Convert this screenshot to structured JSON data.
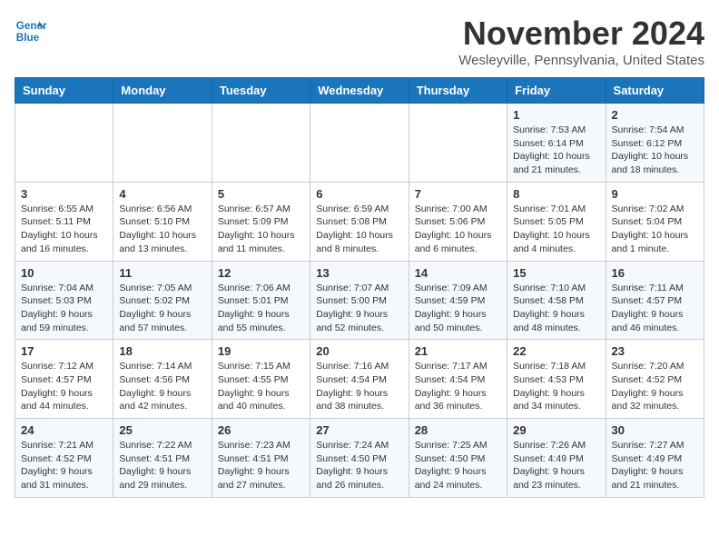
{
  "header": {
    "logo_general": "General",
    "logo_blue": "Blue",
    "month_title": "November 2024",
    "location": "Wesleyville, Pennsylvania, United States"
  },
  "weekdays": [
    "Sunday",
    "Monday",
    "Tuesday",
    "Wednesday",
    "Thursday",
    "Friday",
    "Saturday"
  ],
  "weeks": [
    [
      {
        "day": "",
        "info": ""
      },
      {
        "day": "",
        "info": ""
      },
      {
        "day": "",
        "info": ""
      },
      {
        "day": "",
        "info": ""
      },
      {
        "day": "",
        "info": ""
      },
      {
        "day": "1",
        "info": "Sunrise: 7:53 AM\nSunset: 6:14 PM\nDaylight: 10 hours and 21 minutes."
      },
      {
        "day": "2",
        "info": "Sunrise: 7:54 AM\nSunset: 6:12 PM\nDaylight: 10 hours and 18 minutes."
      }
    ],
    [
      {
        "day": "3",
        "info": "Sunrise: 6:55 AM\nSunset: 5:11 PM\nDaylight: 10 hours and 16 minutes."
      },
      {
        "day": "4",
        "info": "Sunrise: 6:56 AM\nSunset: 5:10 PM\nDaylight: 10 hours and 13 minutes."
      },
      {
        "day": "5",
        "info": "Sunrise: 6:57 AM\nSunset: 5:09 PM\nDaylight: 10 hours and 11 minutes."
      },
      {
        "day": "6",
        "info": "Sunrise: 6:59 AM\nSunset: 5:08 PM\nDaylight: 10 hours and 8 minutes."
      },
      {
        "day": "7",
        "info": "Sunrise: 7:00 AM\nSunset: 5:06 PM\nDaylight: 10 hours and 6 minutes."
      },
      {
        "day": "8",
        "info": "Sunrise: 7:01 AM\nSunset: 5:05 PM\nDaylight: 10 hours and 4 minutes."
      },
      {
        "day": "9",
        "info": "Sunrise: 7:02 AM\nSunset: 5:04 PM\nDaylight: 10 hours and 1 minute."
      }
    ],
    [
      {
        "day": "10",
        "info": "Sunrise: 7:04 AM\nSunset: 5:03 PM\nDaylight: 9 hours and 59 minutes."
      },
      {
        "day": "11",
        "info": "Sunrise: 7:05 AM\nSunset: 5:02 PM\nDaylight: 9 hours and 57 minutes."
      },
      {
        "day": "12",
        "info": "Sunrise: 7:06 AM\nSunset: 5:01 PM\nDaylight: 9 hours and 55 minutes."
      },
      {
        "day": "13",
        "info": "Sunrise: 7:07 AM\nSunset: 5:00 PM\nDaylight: 9 hours and 52 minutes."
      },
      {
        "day": "14",
        "info": "Sunrise: 7:09 AM\nSunset: 4:59 PM\nDaylight: 9 hours and 50 minutes."
      },
      {
        "day": "15",
        "info": "Sunrise: 7:10 AM\nSunset: 4:58 PM\nDaylight: 9 hours and 48 minutes."
      },
      {
        "day": "16",
        "info": "Sunrise: 7:11 AM\nSunset: 4:57 PM\nDaylight: 9 hours and 46 minutes."
      }
    ],
    [
      {
        "day": "17",
        "info": "Sunrise: 7:12 AM\nSunset: 4:57 PM\nDaylight: 9 hours and 44 minutes."
      },
      {
        "day": "18",
        "info": "Sunrise: 7:14 AM\nSunset: 4:56 PM\nDaylight: 9 hours and 42 minutes."
      },
      {
        "day": "19",
        "info": "Sunrise: 7:15 AM\nSunset: 4:55 PM\nDaylight: 9 hours and 40 minutes."
      },
      {
        "day": "20",
        "info": "Sunrise: 7:16 AM\nSunset: 4:54 PM\nDaylight: 9 hours and 38 minutes."
      },
      {
        "day": "21",
        "info": "Sunrise: 7:17 AM\nSunset: 4:54 PM\nDaylight: 9 hours and 36 minutes."
      },
      {
        "day": "22",
        "info": "Sunrise: 7:18 AM\nSunset: 4:53 PM\nDaylight: 9 hours and 34 minutes."
      },
      {
        "day": "23",
        "info": "Sunrise: 7:20 AM\nSunset: 4:52 PM\nDaylight: 9 hours and 32 minutes."
      }
    ],
    [
      {
        "day": "24",
        "info": "Sunrise: 7:21 AM\nSunset: 4:52 PM\nDaylight: 9 hours and 31 minutes."
      },
      {
        "day": "25",
        "info": "Sunrise: 7:22 AM\nSunset: 4:51 PM\nDaylight: 9 hours and 29 minutes."
      },
      {
        "day": "26",
        "info": "Sunrise: 7:23 AM\nSunset: 4:51 PM\nDaylight: 9 hours and 27 minutes."
      },
      {
        "day": "27",
        "info": "Sunrise: 7:24 AM\nSunset: 4:50 PM\nDaylight: 9 hours and 26 minutes."
      },
      {
        "day": "28",
        "info": "Sunrise: 7:25 AM\nSunset: 4:50 PM\nDaylight: 9 hours and 24 minutes."
      },
      {
        "day": "29",
        "info": "Sunrise: 7:26 AM\nSunset: 4:49 PM\nDaylight: 9 hours and 23 minutes."
      },
      {
        "day": "30",
        "info": "Sunrise: 7:27 AM\nSunset: 4:49 PM\nDaylight: 9 hours and 21 minutes."
      }
    ]
  ]
}
